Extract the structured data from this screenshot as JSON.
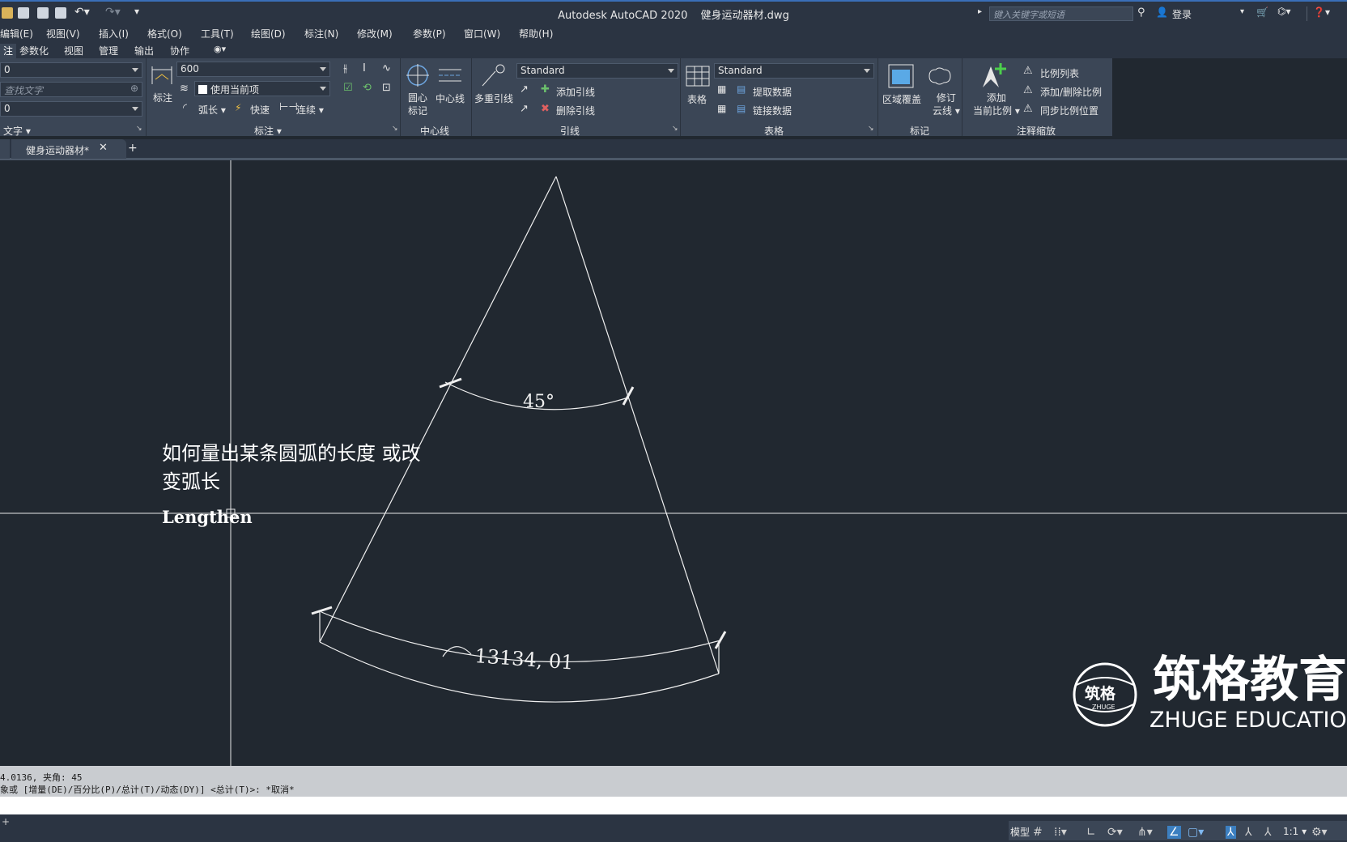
{
  "title_bar": {
    "app_title": "Autodesk AutoCAD 2020",
    "file_name": "健身运动器材.dwg",
    "search_placeholder": "键入关键字或短语",
    "signin_label": "登录"
  },
  "menu": [
    "编辑(E)",
    "视图(V)",
    "插入(I)",
    "格式(O)",
    "工具(T)",
    "绘图(D)",
    "标注(N)",
    "修改(M)",
    "参数(P)",
    "窗口(W)",
    "帮助(H)"
  ],
  "ribbon_tabs": [
    "注",
    "参数化",
    "视图",
    "管理",
    "输出",
    "协作"
  ],
  "ribbon": {
    "text_panel": {
      "combo1": "0",
      "search_placeholder": "查找文字",
      "combo3": "0",
      "title": "文字"
    },
    "dimension_panel": {
      "big_button": "标注",
      "dim_style": "600",
      "layer_combo": "使用当前项",
      "arc_label": "弧长",
      "quick_label": "快速",
      "continue_label": "连续",
      "title": "标注"
    },
    "centerline_panel": {
      "center_mark_l1": "圆心",
      "center_mark_l2": "标记",
      "centerline": "中心线",
      "title": "中心线"
    },
    "leader_panel": {
      "mleader": "多重引线",
      "style": "Standard",
      "add": "添加引线",
      "remove": "删除引线",
      "title": "引线"
    },
    "table_panel": {
      "table": "表格",
      "style": "Standard",
      "extract": "提取数据",
      "link": "链接数据",
      "title": "表格"
    },
    "markup_panel": {
      "wipeout": "区域覆盖",
      "revcloud_l1": "修订",
      "revcloud_l2": "云线",
      "title": "标记"
    },
    "scale_panel": {
      "add_l1": "添加",
      "add_l2": "当前比例",
      "scale_list": "比例列表",
      "add_delete": "添加/删除比例",
      "sync": "同步比例位置",
      "title": "注释缩放"
    }
  },
  "doc_tab": {
    "label": "健身运动器材*"
  },
  "drawing": {
    "angle_dim": "45°",
    "arc_dim": "13134, 01",
    "note_line1": "如何量出某条圆弧的长度 或改",
    "note_line2": "变弧长",
    "command_note": "Lengthen",
    "watermark_cn": "筑格教育",
    "watermark_en": "ZHUGE EDUCATION",
    "logo_cn": "筑格",
    "logo_en": "ZHUGE"
  },
  "command": {
    "line1": "4.0136, 夹角: 45",
    "line2": "象或 [增量(DE)/百分比(P)/总计(T)/动态(DY)] <总计(T)>: *取消*"
  },
  "status_bar": {
    "model_label": "模型",
    "scale_label": "1:1"
  }
}
